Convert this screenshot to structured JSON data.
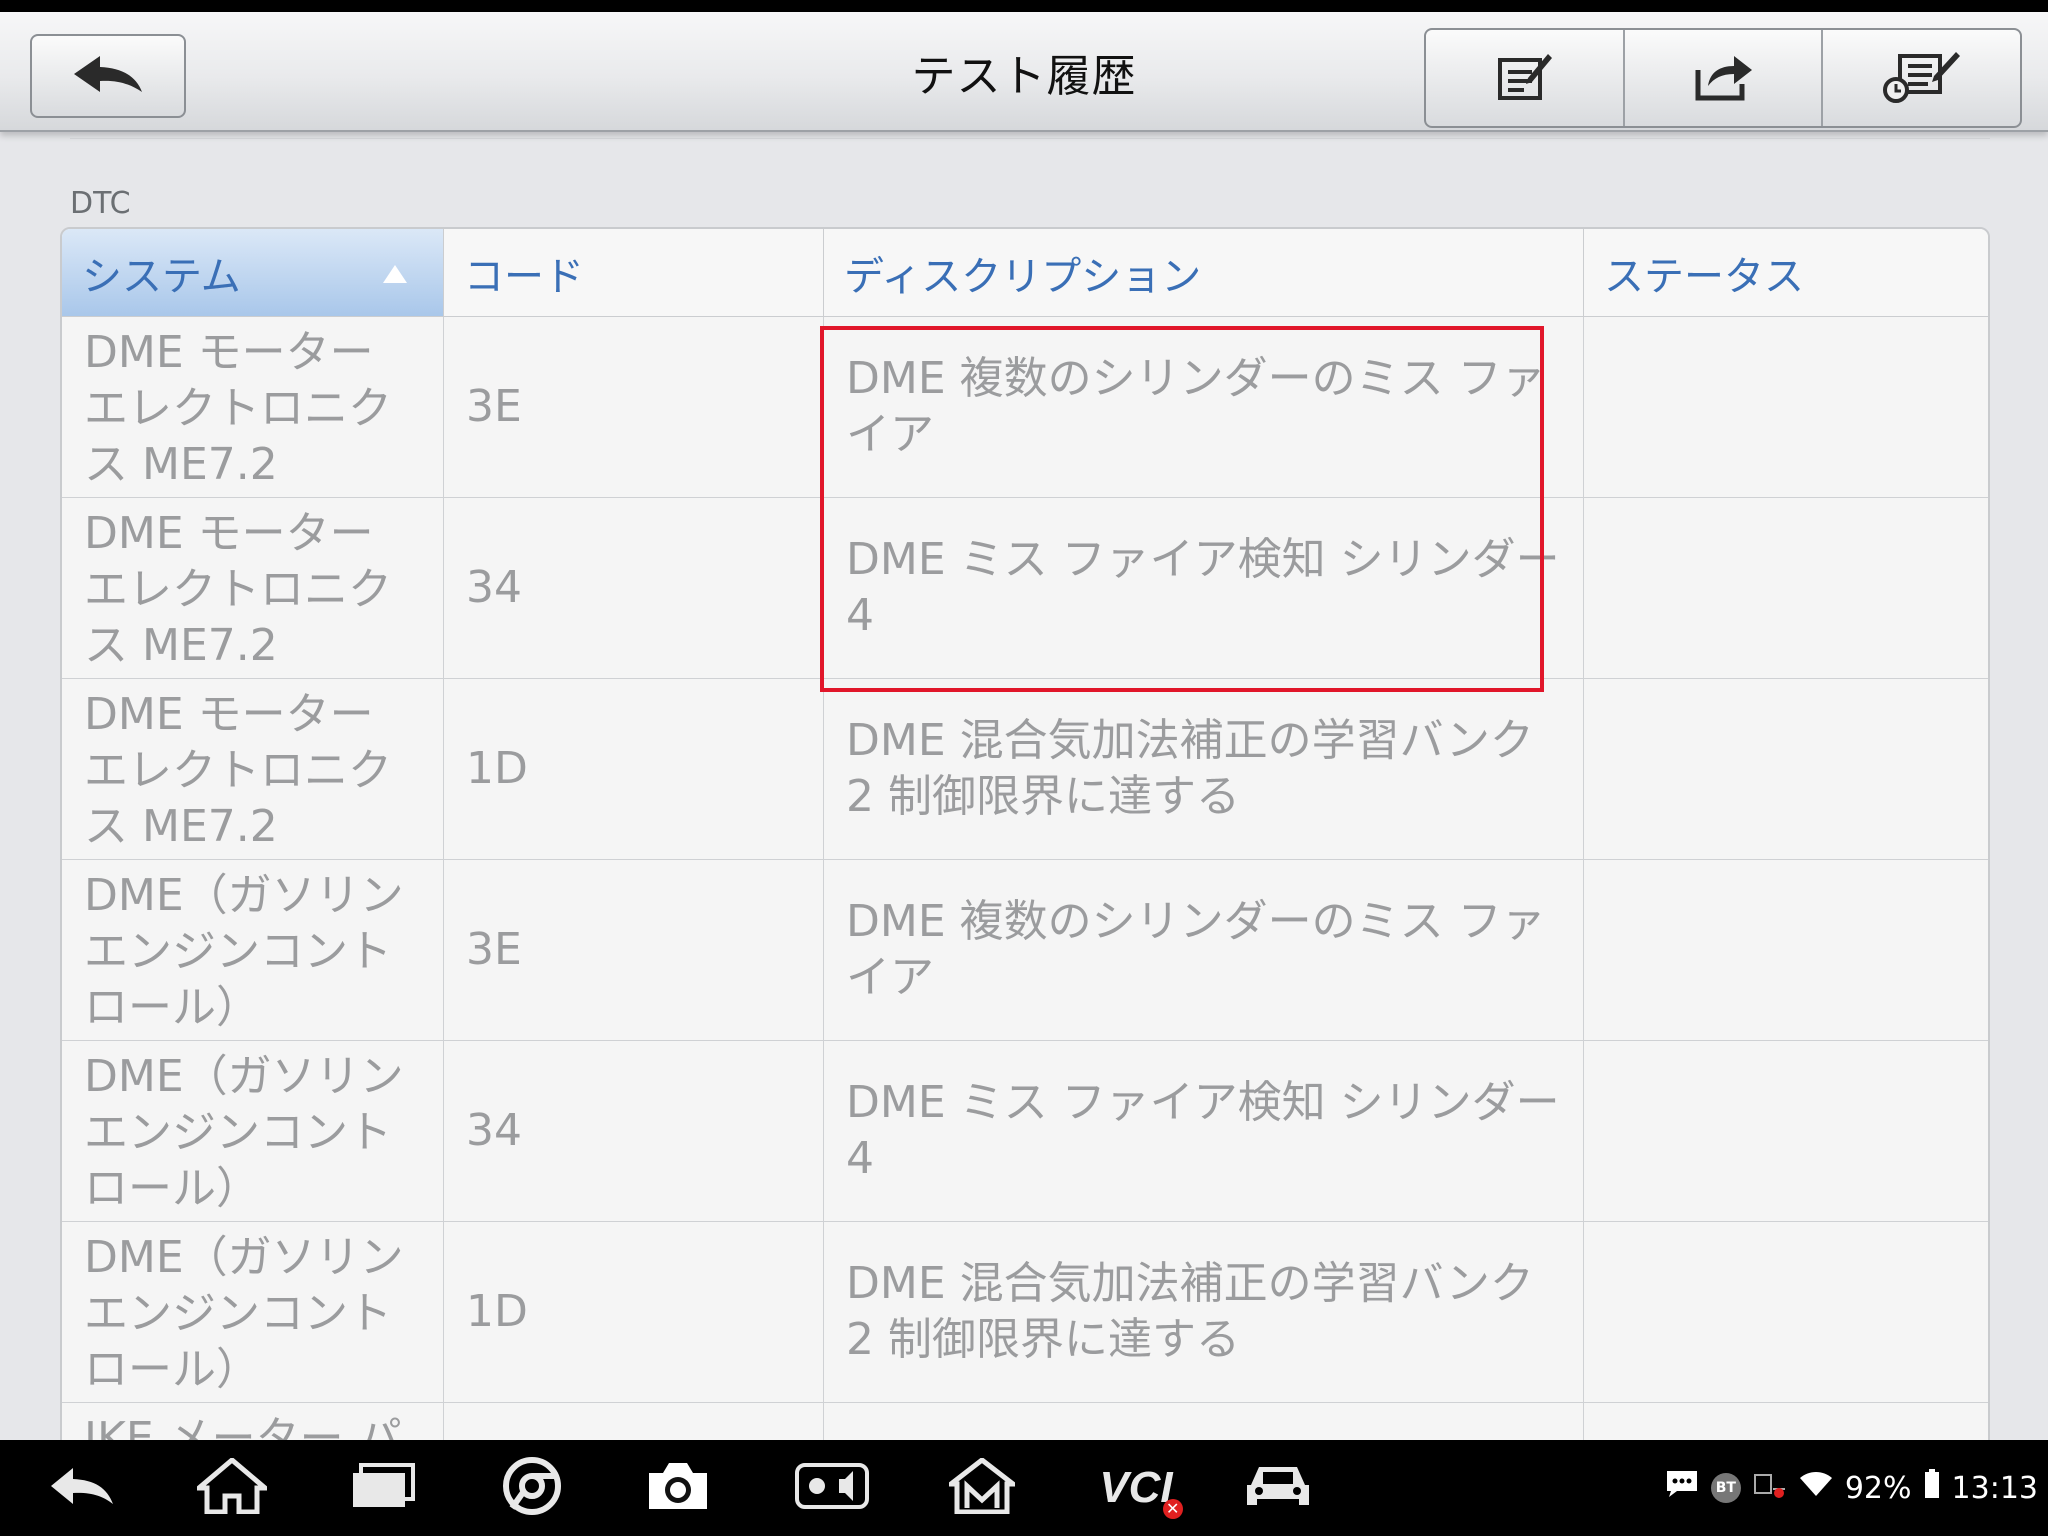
{
  "header": {
    "title": "テスト履歴",
    "back_icon": "back-arrow-icon",
    "actions": [
      {
        "icon": "edit-report-icon"
      },
      {
        "icon": "share-icon"
      },
      {
        "icon": "history-edit-icon"
      }
    ]
  },
  "section": {
    "label": "DTC"
  },
  "table": {
    "columns": [
      "システム",
      "コード",
      "ディスクリプション",
      "ステータス"
    ],
    "sorted_column": "システム",
    "sort_direction": "ascending",
    "rows": [
      {
        "system": "DME モーター エレクトロニクス ME7.2",
        "code": "3E",
        "description": "DME 複数のシリンダーのミス ファイア",
        "status": ""
      },
      {
        "system": "DME モーター エレクトロニクス ME7.2",
        "code": "34",
        "description": "DME ミス ファイア検知 シリンダー 4",
        "status": ""
      },
      {
        "system": "DME モーター エレクトロニクス ME7.2",
        "code": "1D",
        "description": "DME 混合気加法補正の学習バンク 2 制御限界に達する",
        "status": ""
      },
      {
        "system": "DME（ガソリンエンジンコントロール）",
        "code": "3E",
        "description": "DME 複数のシリンダーのミス ファイア",
        "status": ""
      },
      {
        "system": "DME（ガソリンエンジンコントロール）",
        "code": "34",
        "description": "DME ミス ファイア検知 シリンダー 4",
        "status": ""
      },
      {
        "system": "DME（ガソリンエンジンコントロール）",
        "code": "1D",
        "description": "DME 混合気加法補正の学習バンク 2 制御限界に達する",
        "status": ""
      },
      {
        "system": "IKE メーター パ",
        "code": "",
        "description": "",
        "status": ""
      }
    ]
  },
  "highlight_color": "#e1162a",
  "system_bar": {
    "nav_icons": [
      "back-icon",
      "home-icon",
      "recents-icon",
      "chrome-icon",
      "camera-icon",
      "brightness-volume-icon",
      "m-icon",
      "vci-icon",
      "car-icon"
    ],
    "vci_label": "VCI",
    "bt_label": "BT",
    "battery": "92%",
    "time": "13:13"
  }
}
